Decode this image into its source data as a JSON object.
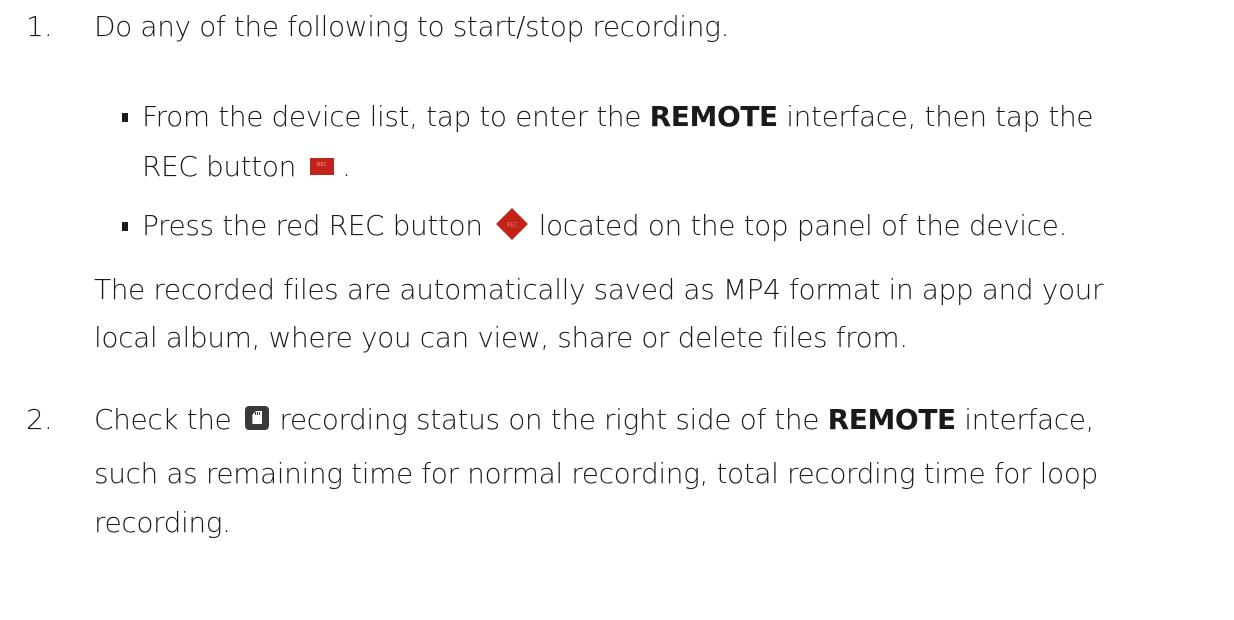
{
  "steps": [
    {
      "number": "1.",
      "lead": "Do any of the following to start/stop recording.",
      "bullets": [
        {
          "line1_before": "From the device list, tap to enter the ",
          "line1_bold": "REMOTE",
          "line1_after": " interface, then tap the",
          "line2_before": "REC button",
          "line2_icon": "rec-button-square-icon",
          "line2_icon_text": "REC",
          "line2_after": "."
        },
        {
          "before": "Press the red REC button",
          "icon": "rec-button-diamond-icon",
          "icon_text": "REC",
          "after": "located on the top panel of the device."
        }
      ],
      "note_line1": "The recorded files are automatically saved as MP4 format in app and your",
      "note_line2": "local album, where you can view, share or delete files from."
    },
    {
      "number": "2.",
      "line1_before": "Check the",
      "line1_icon": "sd-card-icon",
      "line1_middle": "recording status on the right side of the ",
      "line1_bold": "REMOTE",
      "line1_after": " interface,",
      "line2": "such as remaining time for normal recording, total recording time for loop",
      "line3": "recording."
    }
  ],
  "colors": {
    "text": "#1a1a1a",
    "rec_red": "#c0231a",
    "sd_icon": "#3a3a3a"
  }
}
